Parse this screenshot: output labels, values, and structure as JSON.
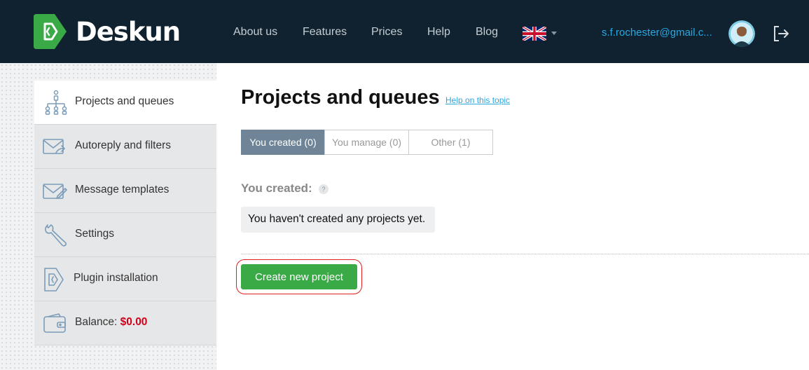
{
  "header": {
    "brand": "Deskun",
    "nav": [
      {
        "label": "About us"
      },
      {
        "label": "Features"
      },
      {
        "label": "Prices"
      },
      {
        "label": "Help"
      },
      {
        "label": "Blog"
      }
    ],
    "language_icon": "uk-flag-icon",
    "user_email": "s.f.rochester@gmail.c...",
    "logout_icon": "logout-icon"
  },
  "sidebar": {
    "items": [
      {
        "label": "Projects and queues",
        "icon": "hierarchy-icon",
        "active": true
      },
      {
        "label": "Autoreply and filters",
        "icon": "mail-forward-icon"
      },
      {
        "label": "Message templates",
        "icon": "mail-edit-icon"
      },
      {
        "label": "Settings",
        "icon": "wrench-icon"
      },
      {
        "label": "Plugin installation",
        "icon": "plugin-icon"
      },
      {
        "label": "Balance:",
        "amount": "$0.00",
        "icon": "wallet-icon"
      }
    ]
  },
  "main": {
    "title": "Projects and queues",
    "help_link": "Help on this topic",
    "tabs": [
      {
        "label": "You created (0)",
        "active": true
      },
      {
        "label": "You manage (0)"
      },
      {
        "label": "Other (1)"
      }
    ],
    "section_title": "You created:",
    "help_tooltip": "?",
    "empty_message": "You haven't created any projects yet.",
    "create_button": "Create new project"
  },
  "colors": {
    "header_bg": "#10222f",
    "accent_blue": "#29a7e0",
    "button_green": "#3aaa46",
    "active_tab": "#6f8597",
    "balance_red": "#d0021b",
    "highlight_red": "#e02020"
  }
}
